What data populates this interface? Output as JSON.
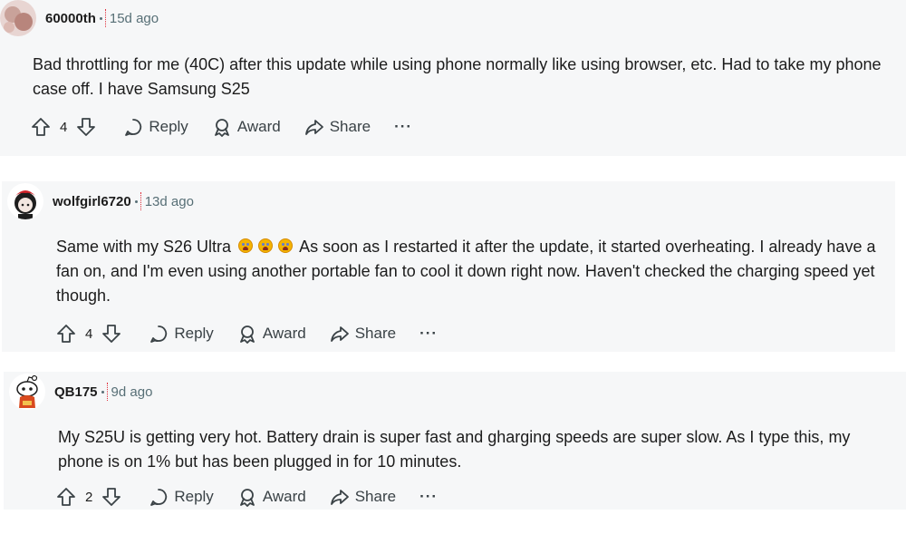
{
  "comments": [
    {
      "username": "60000th",
      "time": "15d ago",
      "body": "Bad throttling for me (40C) after this update while using phone normally like using browser, etc. Had to take my phone case off. I have Samsung S25",
      "votes": "4",
      "avatar_icon": "user-avatar-pink",
      "actions": {
        "reply": "Reply",
        "award": "Award",
        "share": "Share",
        "more": "···"
      }
    },
    {
      "username": "wolfgirl6720",
      "time": "13d ago",
      "body_before_emoji": "Same with my S26 Ultra",
      "emoji_icon": "crying-face-emoji",
      "body_after_emoji": "As soon as I restarted it after the update, it started overheating. I already have a fan on, and I'm even using another portable fan to cool it down right now. Haven't checked the charging speed yet though.",
      "votes": "4",
      "avatar_icon": "user-avatar-red-hair",
      "actions": {
        "reply": "Reply",
        "award": "Award",
        "share": "Share",
        "more": "···"
      }
    },
    {
      "username": "QB175",
      "time": "9d ago",
      "body": "My S25U is getting very hot. Battery drain is super fast and gharging speeds are super slow. As I type this, my phone is on 1% but has been plugged in for 10 minutes.",
      "votes": "2",
      "avatar_icon": "user-avatar-snoo",
      "actions": {
        "reply": "Reply",
        "award": "Award",
        "share": "Share",
        "more": "···"
      }
    }
  ],
  "colors": {
    "card_background": "#f6f7f8",
    "meta_text": "#576f76",
    "thread_line": "#e0303c"
  }
}
